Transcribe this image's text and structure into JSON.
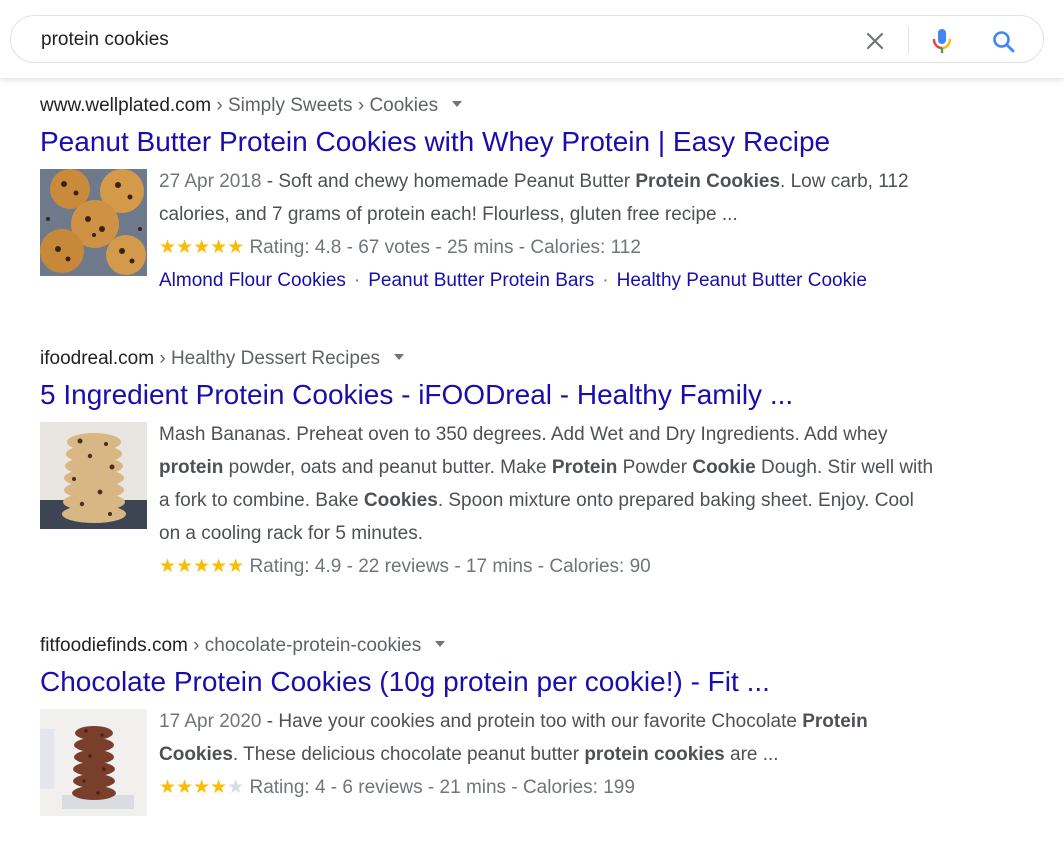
{
  "search": {
    "query": "protein cookies"
  },
  "results": [
    {
      "domain": "www.wellplated.com",
      "path": "› Simply Sweets › Cookies",
      "title": "Peanut Butter Protein Cookies with Whey Protein | Easy Recipe",
      "image": "peanut-butter-cookies-photo",
      "date": "27 Apr 2018",
      "snippet_parts": [
        " - Soft and chewy homemade Peanut Butter ",
        "Protein Cookies",
        ". Low carb, 112 calories, and 7 grams of protein each! Flourless, gluten free recipe ..."
      ],
      "stars": "★★★★★",
      "rating_text": "Rating: 4.8 - 67 votes - 25 mins - Calories: 112",
      "sitelinks": [
        "Almond Flour Cookies",
        "Peanut Butter Protein Bars",
        "Healthy Peanut Butter Cookie"
      ]
    },
    {
      "domain": "ifoodreal.com",
      "path": "› Healthy Dessert Recipes",
      "title": "5 Ingredient Protein Cookies - iFOODreal - Healthy Family ...",
      "image": "stacked-oat-cookies-photo",
      "snippet_parts": [
        "Mash Bananas. Preheat oven to 350 degrees. Add Wet and Dry Ingredients. Add whey ",
        "protein",
        " powder, oats and peanut butter. Make ",
        "Protein",
        " Powder ",
        "Cookie",
        " Dough. Stir well with a fork to combine. Bake ",
        "Cookies",
        ". Spoon mixture onto prepared baking sheet. Enjoy. Cool on a cooling rack for 5 minutes."
      ],
      "stars": "★★★★★",
      "rating_text": "Rating: 4.9 - 22 reviews - 17 mins - Calories: 90"
    },
    {
      "domain": "fitfoodiefinds.com",
      "path": "› chocolate-protein-cookies",
      "title": "Chocolate Protein Cookies (10g protein per cookie!) - Fit ...",
      "image": "chocolate-cookie-stack-photo",
      "date": "17 Apr 2020",
      "snippet_parts": [
        " - Have your cookies and protein too with our favorite Chocolate ",
        "Protein Cookies",
        ". These delicious chocolate peanut butter ",
        "protein cookies",
        " are ..."
      ],
      "stars": "★★★★",
      "stars_off": "★",
      "rating_text": "Rating: 4 - 6 reviews - 21 mins - Calories: 199"
    }
  ],
  "colors": {
    "link": "#1a0dab",
    "star": "#fbbc04",
    "text": "#4d5156"
  }
}
